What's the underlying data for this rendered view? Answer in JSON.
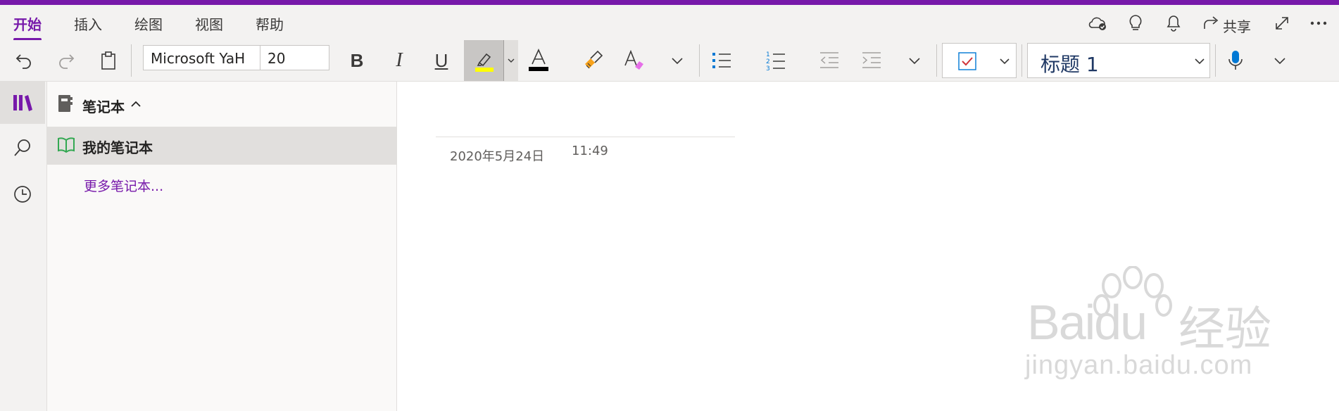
{
  "menu": {
    "tabs": [
      {
        "label": "开始",
        "active": true
      },
      {
        "label": "插入",
        "active": false
      },
      {
        "label": "绘图",
        "active": false
      },
      {
        "label": "视图",
        "active": false
      },
      {
        "label": "帮助",
        "active": false
      }
    ],
    "share_label": "共享"
  },
  "toolbar": {
    "font_name": "Microsoft YaH",
    "font_size": "20",
    "style_value": "标题 1",
    "highlight_color": "#ffff00",
    "font_color": "#000000"
  },
  "notebooks": {
    "header_label": "笔记本",
    "items": [
      {
        "label": "我的笔记本",
        "selected": true
      }
    ],
    "more_link": "更多笔记本..."
  },
  "page": {
    "date": "2020年5月24日",
    "time": "11:49"
  },
  "watermark": {
    "brand": "Baidu",
    "jingyan": "经验",
    "url": "jingyan.baidu.com"
  },
  "colors": {
    "accent": "#7719aa",
    "notebook_icon": "#33a852"
  }
}
